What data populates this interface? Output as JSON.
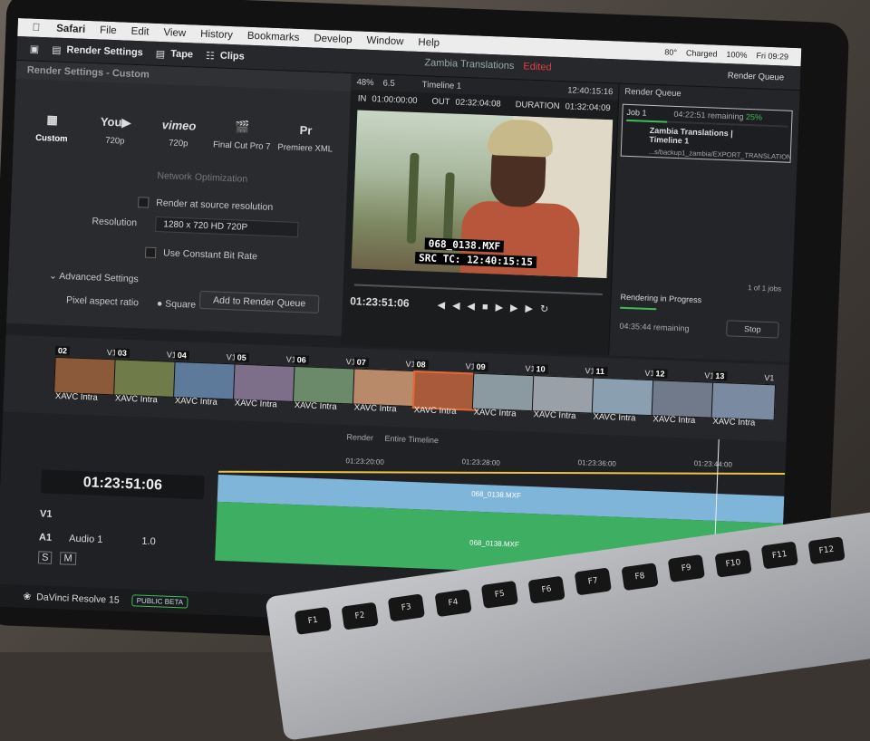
{
  "menubar": {
    "app": "Safari",
    "items": [
      "File",
      "Edit",
      "View",
      "History",
      "Bookmarks",
      "Develop",
      "Window",
      "Help"
    ],
    "status": {
      "temp": "80°",
      "battery_state": "Charged",
      "battery": "100%",
      "clock": "Fri 09:29"
    }
  },
  "topbar": {
    "render_settings": "Render Settings",
    "tape": "Tape",
    "clips": "Clips",
    "project": "Zambia Translations",
    "edited": "Edited",
    "render_queue": "Render Queue"
  },
  "render_panel": {
    "title": "Render Settings - Custom",
    "presets": [
      {
        "icon": "film-icon",
        "label": "Custom"
      },
      {
        "icon": "youtube-logo",
        "label": "720p"
      },
      {
        "icon": "vimeo-logo",
        "label": "720p"
      },
      {
        "icon": "clapper-icon",
        "label": "Final Cut Pro 7"
      },
      {
        "icon": "premiere-icon",
        "label": "Premiere XML"
      }
    ],
    "network": "Network Optimization",
    "source_res": "Render at source resolution",
    "resolution_label": "Resolution",
    "resolution_value": "1280 x 720 HD 720P",
    "cbr": "Use Constant Bit Rate",
    "advanced": "Advanced Settings",
    "par_label": "Pixel aspect ratio",
    "par_value": "Square",
    "add_queue": "Add to Render Queue"
  },
  "viewer": {
    "zoom": "48%",
    "fps": "6.5",
    "timeline": "Timeline 1",
    "tc_top": "12:40:15:16",
    "in_label": "IN",
    "in": "01:00:00:00",
    "out_label": "OUT",
    "out": "02:32:04:08",
    "dur_label": "DURATION",
    "dur": "01:32:04:09",
    "overlay1": "068_0138.MXF",
    "overlay2": "SRC TC: 12:40:15:15",
    "timecode": "01:23:51:06"
  },
  "render_queue": {
    "title": "Render Queue",
    "job": "Job 1",
    "remaining": "04:22:51 remaining",
    "percent": "25%",
    "job_name": "Zambia Translations | Timeline 1",
    "job_path": "...s/backup1_zambia/EXPORT_TRANSLATION",
    "jobs_count": "1 of 1 jobs",
    "progress_label": "Rendering in Progress",
    "elapsed": "04:35:44 remaining",
    "stop": "Stop",
    "progress": 0.25
  },
  "clips": [
    {
      "num": "02",
      "v": "V1",
      "cap": "XAVC Intra"
    },
    {
      "num": "03",
      "v": "V1",
      "cap": "XAVC Intra"
    },
    {
      "num": "04",
      "v": "V1",
      "cap": "XAVC Intra"
    },
    {
      "num": "05",
      "v": "V1",
      "cap": "XAVC Intra"
    },
    {
      "num": "06",
      "v": "V1",
      "cap": "XAVC Intra"
    },
    {
      "num": "07",
      "v": "V1",
      "cap": "XAVC Intra"
    },
    {
      "num": "08",
      "v": "V1",
      "cap": "XAVC Intra"
    },
    {
      "num": "09",
      "v": "V1",
      "cap": "XAVC Intra"
    },
    {
      "num": "10",
      "v": "V1",
      "cap": "XAVC Intra"
    },
    {
      "num": "11",
      "v": "V1",
      "cap": "XAVC Intra"
    },
    {
      "num": "12",
      "v": "V1",
      "cap": "XAVC Intra"
    },
    {
      "num": "13",
      "v": "V1",
      "cap": "XAVC Intra"
    }
  ],
  "timeline": {
    "render_label": "Render",
    "render_value": "Entire Timeline",
    "ruler": [
      "01:23:20:00",
      "01:23:28:00",
      "01:23:36:00",
      "01:23:44:00",
      "01:23:52:00"
    ],
    "timecode": "01:23:51:06",
    "clip_v": "068_0138.MXF",
    "clip_a": "068_0138.MXF",
    "v1": "V1",
    "a1": "A1",
    "audio": "Audio 1",
    "vol": "1.0",
    "s": "S",
    "m": "M"
  },
  "footer": {
    "app": "DaVinci Resolve 15",
    "beta": "PUBLIC BETA"
  },
  "keyboard": [
    "F1",
    "F2",
    "F3",
    "F4",
    "F5",
    "F6",
    "F7",
    "F8",
    "F9",
    "F10",
    "F11",
    "F12"
  ]
}
